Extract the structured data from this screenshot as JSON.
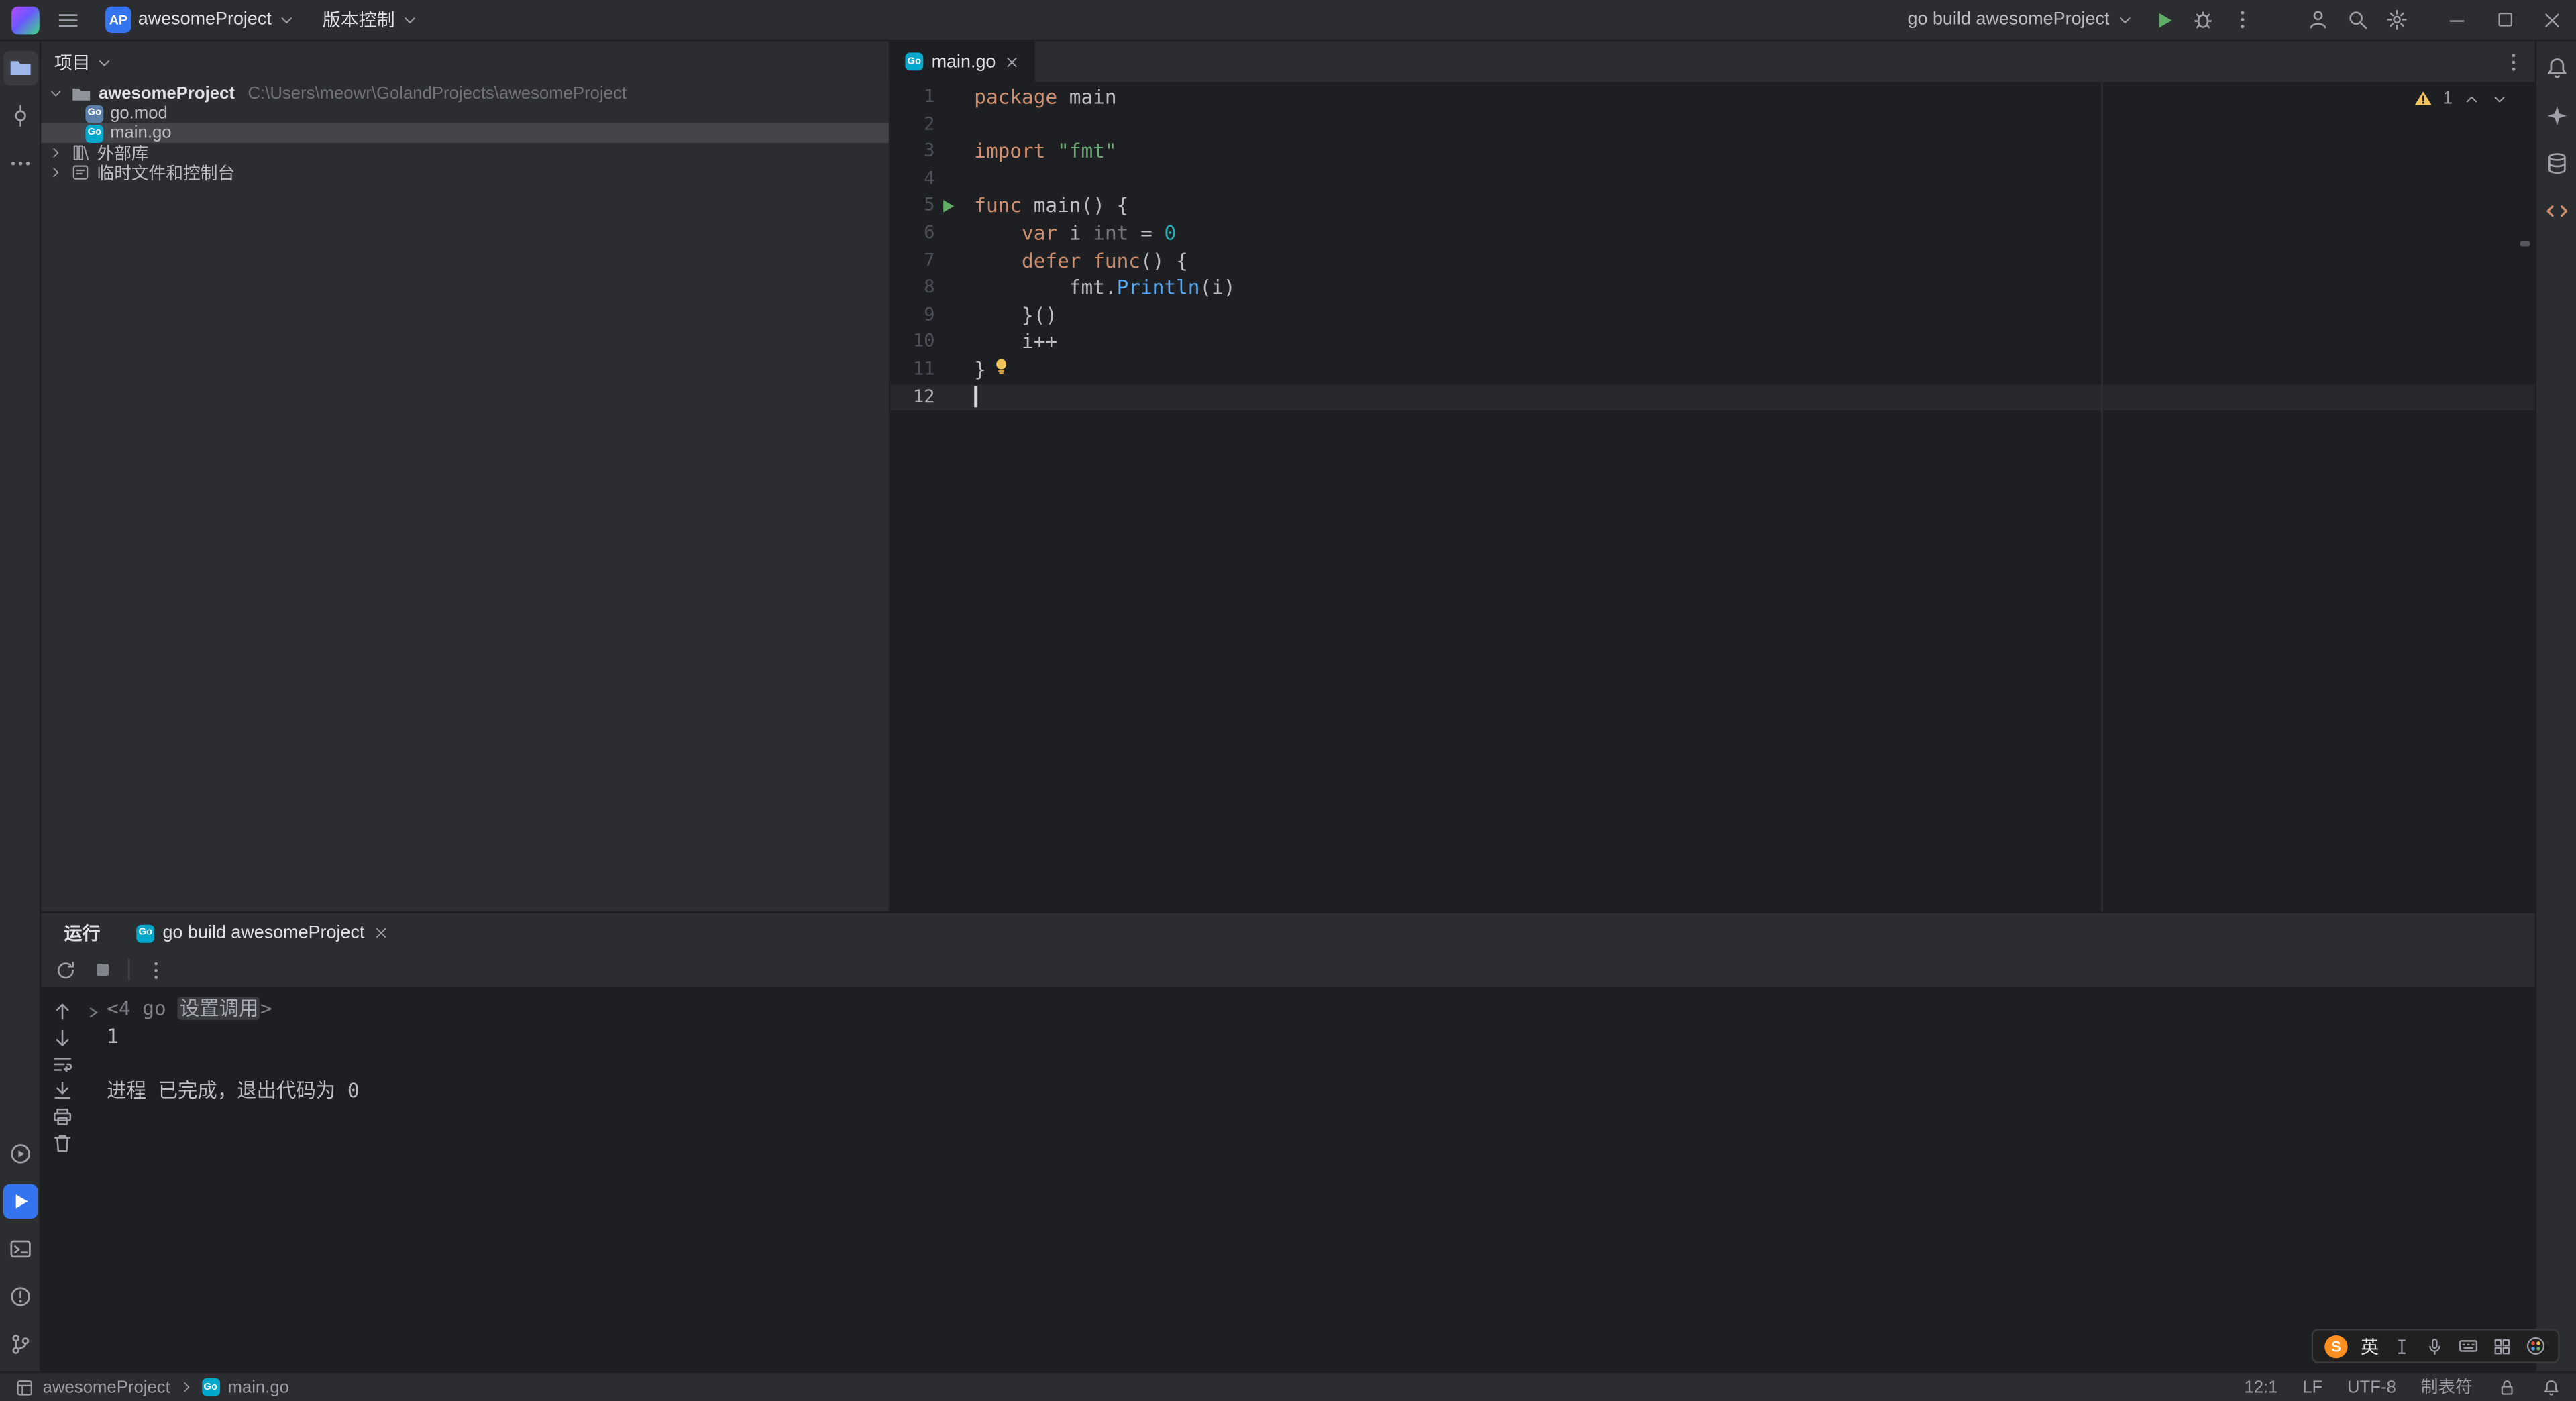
{
  "window": {
    "title_project": "awesomeProject",
    "avatar": "AP",
    "vcs_label": "版本控制",
    "run_config": "go build awesomeProject"
  },
  "project_panel": {
    "title": "项目",
    "root_name": "awesomeProject",
    "root_path": "C:\\Users\\meowr\\GolandProjects\\awesomeProject",
    "items": {
      "go_mod": "go.mod",
      "main_go": "main.go",
      "external_libs": "外部库",
      "scratches": "临时文件和控制台"
    }
  },
  "editor": {
    "tab": "main.go",
    "warning_count": "1",
    "lines": [
      {
        "n": "1",
        "tokens": [
          [
            "k",
            "package"
          ],
          [
            "p",
            " main"
          ]
        ]
      },
      {
        "n": "2",
        "tokens": []
      },
      {
        "n": "3",
        "tokens": [
          [
            "k",
            "import"
          ],
          [
            "p",
            " "
          ],
          [
            "s",
            "\"fmt\""
          ]
        ]
      },
      {
        "n": "4",
        "tokens": []
      },
      {
        "n": "5",
        "run": true,
        "tokens": [
          [
            "k",
            "func"
          ],
          [
            "p",
            " main() {"
          ]
        ]
      },
      {
        "n": "6",
        "tokens": [
          [
            "p",
            "    "
          ],
          [
            "k",
            "var"
          ],
          [
            "p",
            " i "
          ],
          [
            "g",
            "int"
          ],
          [
            "p",
            " = "
          ],
          [
            "c",
            "0"
          ]
        ]
      },
      {
        "n": "7",
        "tokens": [
          [
            "p",
            "    "
          ],
          [
            "k",
            "defer"
          ],
          [
            "p",
            " "
          ],
          [
            "k",
            "func"
          ],
          [
            "p",
            "() {"
          ]
        ]
      },
      {
        "n": "8",
        "tokens": [
          [
            "p",
            "        fmt."
          ],
          [
            "f",
            "Println"
          ],
          [
            "p",
            "(i)"
          ]
        ]
      },
      {
        "n": "9",
        "tokens": [
          [
            "p",
            "    }()"
          ]
        ]
      },
      {
        "n": "10",
        "tokens": [
          [
            "p",
            "    i++"
          ]
        ]
      },
      {
        "n": "11",
        "bulb": true,
        "tokens": [
          [
            "p",
            "}"
          ]
        ]
      },
      {
        "n": "12",
        "caret": true,
        "tokens": []
      }
    ]
  },
  "run_panel": {
    "title": "运行",
    "tab": "go build awesomeProject",
    "console_lines": [
      {
        "fold": true,
        "tokens": [
          [
            "dim",
            "<4 go "
          ],
          [
            "fold",
            "设置调用"
          ],
          [
            "dim",
            ">"
          ]
        ]
      },
      {
        "tokens": [
          [
            "p",
            "1"
          ]
        ]
      },
      {
        "tokens": []
      },
      {
        "tokens": [
          [
            "p",
            "进程 已完成，退出代码为 0"
          ]
        ]
      }
    ]
  },
  "status_bar": {
    "project": "awesomeProject",
    "file": "main.go",
    "caret": "12:1",
    "line_sep": "LF",
    "encoding": "UTF-8",
    "indent": "制表符"
  },
  "ime": {
    "lang": "英"
  },
  "icons": {
    "go_badge": "Go",
    "sogou": "S"
  },
  "colors": {
    "accent": "#3574f0",
    "run_green": "#5fad65",
    "warning": "#f2c55c",
    "editor_bg": "#1e1f22",
    "panel_bg": "#2b2d30"
  }
}
